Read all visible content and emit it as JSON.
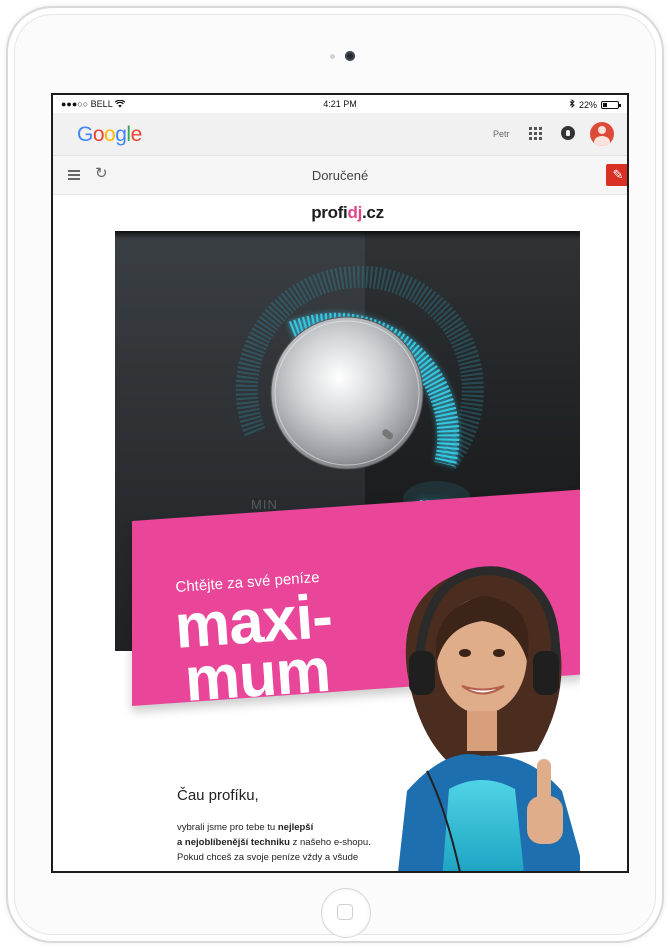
{
  "status_bar": {
    "carrier": "●●●○○ BELL",
    "time": "4:21 PM",
    "battery": "22%",
    "battery_level": 0.22
  },
  "gmail_header": {
    "logo_letters": [
      "G",
      "o",
      "o",
      "g",
      "l",
      "e"
    ],
    "user_name": "Petr"
  },
  "toolbar": {
    "title": "Doručené",
    "compose_symbol": "✎",
    "refresh_symbol": "↻"
  },
  "email": {
    "brand_prefix": "profi",
    "brand_highlight": "dj",
    "brand_suffix": ".cz",
    "knob_min_label": "MIN",
    "knob_max_label": "MAX",
    "tagline": "Chtějte za své peníze",
    "headline_line1": "maxi-",
    "headline_line2": "mum",
    "greeting": "Čau profíku,",
    "body_1": "vybrali jsme pro tebe tu ",
    "body_bold_1": "nejlepší",
    "body_bold_2": "a nejoblíbenější techniku",
    "body_2": " z našeho e-shopu.",
    "body_3": "Pokud chceš za svoje peníze vždy a všude"
  },
  "colors": {
    "accent_pink": "#e9469a",
    "knob_glow": "#3ec6e0",
    "compose_red": "#d93025",
    "avatar_red": "#dc4a38"
  },
  "icons": [
    "wifi-icon",
    "bluetooth-icon",
    "battery-icon",
    "apps-grid-icon",
    "notifications-icon",
    "avatar-icon",
    "menu-icon",
    "refresh-icon",
    "pencil-icon",
    "home-button"
  ]
}
